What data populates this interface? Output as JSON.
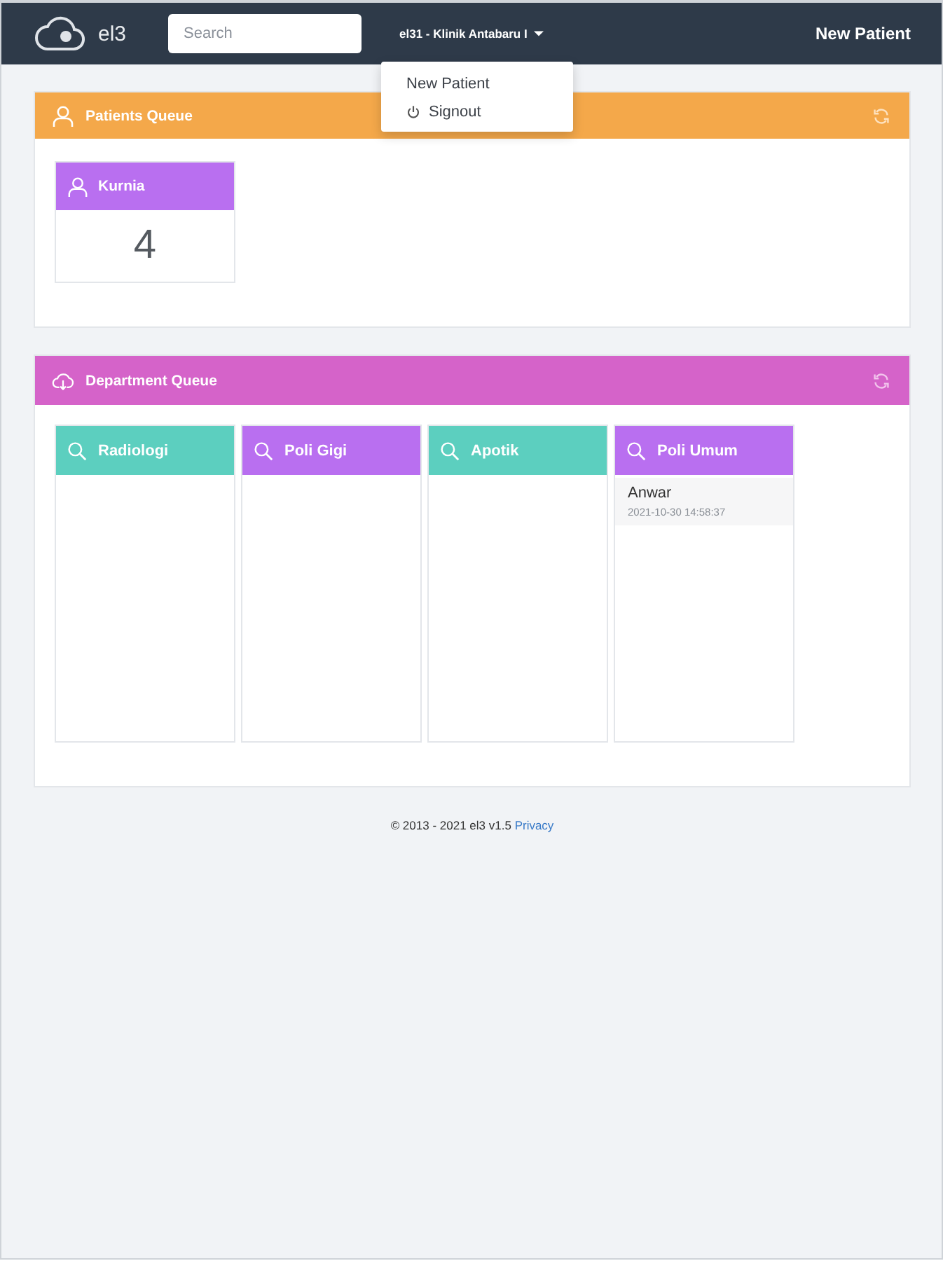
{
  "navbar": {
    "brand": "el3",
    "search": {
      "placeholder": "Search"
    },
    "account_menu": {
      "label": "el31 - Klinik Antabaru I",
      "expanded": true,
      "items": [
        {
          "label": "New Patient",
          "kind": "plain"
        },
        {
          "label": "Signout",
          "kind": "signout"
        }
      ]
    },
    "new_patient_link": "New Patient"
  },
  "patients_queue": {
    "title": "Patients Queue",
    "queues": [
      {
        "name": "Kurnia",
        "count": "4"
      }
    ]
  },
  "department_queue": {
    "title": "Department Queue",
    "departments": [
      {
        "name": "Radiologi",
        "color": "#5ccfbf"
      },
      {
        "name": "Poli Gigi",
        "color": "#b96ff0"
      },
      {
        "name": "Apotik",
        "color": "#5ccfbf"
      },
      {
        "name": "Poli Umum",
        "color": "#b96ff0",
        "patients": [
          {
            "name": "Anwar",
            "time": "2021-10-30 14:58:37"
          }
        ]
      }
    ]
  },
  "footer": {
    "text": "© 2013 - 2021 el3 v1.5",
    "link": "Privacy"
  }
}
